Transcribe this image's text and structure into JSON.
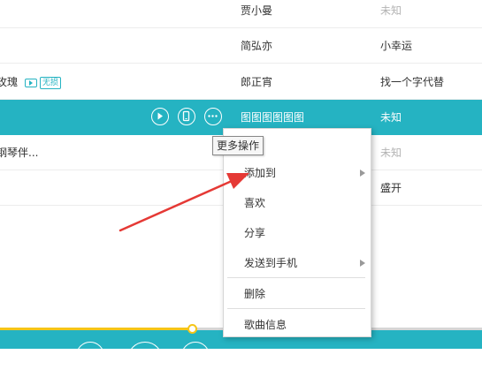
{
  "rows": [
    {
      "song": "",
      "artist": "贾小曼",
      "album": "未知",
      "album_muted": true
    },
    {
      "song": "",
      "artist": "简弘亦",
      "album": "小幸运",
      "album_muted": false
    },
    {
      "song": "玫瑰",
      "mv_icon": "tv-play-icon",
      "badge": "无损",
      "artist": "郎正宵",
      "album": "找一个字代替",
      "album_muted": false
    },
    {
      "song": "",
      "artist": "图图图图图图",
      "album": "未知",
      "album_muted": false,
      "active": true
    },
    {
      "song": "钢琴伴...",
      "artist": "",
      "album": "未知",
      "album_muted": true
    },
    {
      "song": "",
      "artist": "",
      "album": "盛开",
      "album_muted": false
    }
  ],
  "row_icons": [
    "play-circle-icon",
    "phone-icon",
    "more-circle-icon"
  ],
  "tooltip": "更多操作",
  "context_menu": {
    "items": [
      {
        "label": "添加到",
        "has_submenu": true
      },
      {
        "label": "喜欢",
        "has_submenu": false
      },
      {
        "label": "分享",
        "has_submenu": false
      },
      {
        "label": "发送到手机",
        "has_submenu": true
      },
      {
        "label": "删除",
        "has_submenu": false
      },
      {
        "label": "歌曲信息",
        "has_submenu": false
      }
    ]
  },
  "player": {
    "progress": 0.4
  },
  "colors": {
    "accent": "#25b3c2",
    "progress": "#f5c518",
    "arrow": "#e53935",
    "muted_text": "#b3b3b3"
  }
}
